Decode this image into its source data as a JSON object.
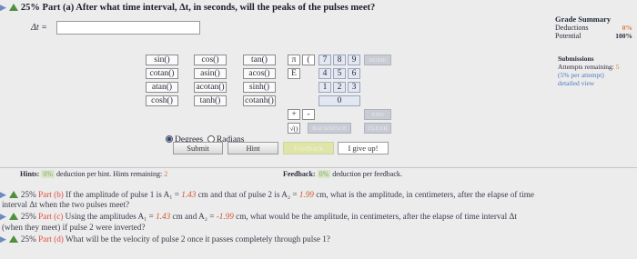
{
  "part_a": {
    "percent": "25%",
    "label": "Part (a)",
    "question": "After what time interval, Δt, in seconds, will the peaks of the pulses meet?",
    "answer_label": "Δt =",
    "answer_value": ""
  },
  "calculator": {
    "functions": [
      [
        "sin()",
        "cos()",
        "tan()"
      ],
      [
        "cotan()",
        "asin()",
        "acos()"
      ],
      [
        "atan()",
        "acotan()",
        "sinh()"
      ],
      [
        "cosh()",
        "tanh()",
        "cotanh()"
      ]
    ],
    "symbols": [
      "π",
      "(",
      "E",
      "+",
      "-",
      "√()"
    ],
    "digits": [
      [
        "7",
        "8",
        "9"
      ],
      [
        "4",
        "5",
        "6"
      ],
      [
        "1",
        "2",
        "3"
      ],
      [
        "0"
      ]
    ],
    "grayed": [
      "HOME",
      "END",
      "BACKSPACE",
      "DEL",
      "CLEAR"
    ],
    "angle_modes": [
      "Degrees",
      "Radians"
    ],
    "angle_selected": "Degrees"
  },
  "actions": {
    "submit": "Submit",
    "hint": "Hint",
    "feedback": "Feedback",
    "give_up": "I give up!"
  },
  "hints": {
    "label": "Hints:",
    "percent": "0%",
    "text": "deduction per hint. Hints remaining:",
    "remaining": "2"
  },
  "feedback": {
    "label": "Feedback:",
    "percent": "0%",
    "text": "deduction per feedback."
  },
  "grade_summary": {
    "title": "Grade Summary",
    "deductions_label": "Deductions",
    "deductions_value": "0%",
    "potential_label": "Potential",
    "potential_value": "100%"
  },
  "submissions": {
    "title": "Submissions",
    "attempts_text": "Attempts remaining:",
    "attempts_value": "5",
    "per_attempt": "(5% per attempt)",
    "detailed_view": "detailed view"
  },
  "other_parts": {
    "b": {
      "percent": "25%",
      "label": "Part (b)",
      "text1": "If the amplitude of pulse 1 is A₁ =",
      "val1": "1.43",
      "text2": "cm and that of pulse 2 is A₂ =",
      "val2": "1.99",
      "text3": "cm, what is the amplitude, in centimeters, after the elapse of time",
      "line2": "interval Δt when the two pulses meet?"
    },
    "c": {
      "percent": "25%",
      "label": "Part (c)",
      "text1": "Using the amplitudes A₁ =",
      "val1": "1.43",
      "text2": "cm and A₂ =",
      "val2": "-1.99",
      "text3": "cm, what would be the amplitude, in centimeters, after the elapse of time interval Δt",
      "line2": "(when they meet) if pulse 2 were inverted?"
    },
    "d": {
      "percent": "25%",
      "label": "Part (d)",
      "text": "What will be the velocity of pulse 2 once it passes completely through pulse 1?"
    }
  }
}
